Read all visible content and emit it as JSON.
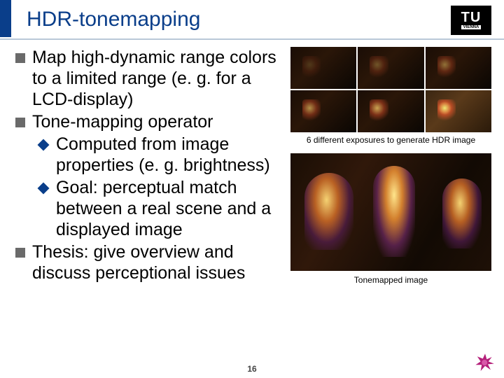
{
  "title": "HDR-tonemapping",
  "logo": {
    "main": "TU",
    "sub": "VIENNA"
  },
  "bullets": [
    {
      "text": "Map high-dynamic range colors to a limited range (e. g. for a LCD-display)"
    },
    {
      "text": "Tone-mapping operator",
      "sub": [
        "Computed from image properties (e. g. brightness)",
        "Goal: perceptual match between a real scene and a displayed image"
      ]
    },
    {
      "text": "Thesis: give overview and discuss perceptional issues"
    }
  ],
  "captions": {
    "grid": "6 different exposures to generate HDR image",
    "big": "Tonemapped image"
  },
  "page": "16"
}
